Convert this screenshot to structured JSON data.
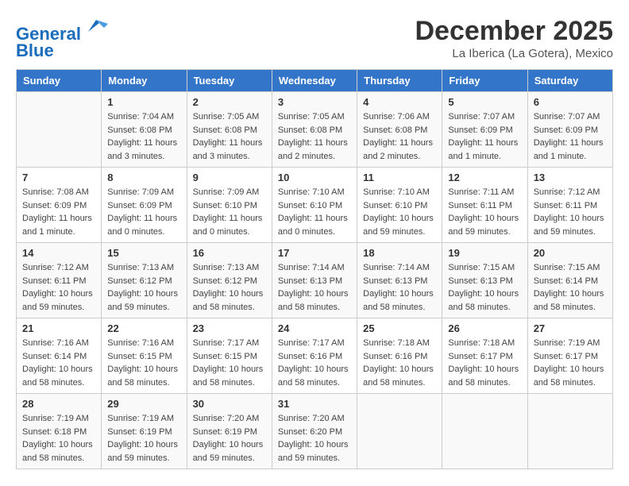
{
  "header": {
    "logo_line1": "General",
    "logo_line2": "Blue",
    "month": "December 2025",
    "location": "La Iberica (La Gotera), Mexico"
  },
  "days_of_week": [
    "Sunday",
    "Monday",
    "Tuesday",
    "Wednesday",
    "Thursday",
    "Friday",
    "Saturday"
  ],
  "weeks": [
    [
      {
        "day": "",
        "info": ""
      },
      {
        "day": "1",
        "info": "Sunrise: 7:04 AM\nSunset: 6:08 PM\nDaylight: 11 hours\nand 3 minutes."
      },
      {
        "day": "2",
        "info": "Sunrise: 7:05 AM\nSunset: 6:08 PM\nDaylight: 11 hours\nand 3 minutes."
      },
      {
        "day": "3",
        "info": "Sunrise: 7:05 AM\nSunset: 6:08 PM\nDaylight: 11 hours\nand 2 minutes."
      },
      {
        "day": "4",
        "info": "Sunrise: 7:06 AM\nSunset: 6:08 PM\nDaylight: 11 hours\nand 2 minutes."
      },
      {
        "day": "5",
        "info": "Sunrise: 7:07 AM\nSunset: 6:09 PM\nDaylight: 11 hours\nand 1 minute."
      },
      {
        "day": "6",
        "info": "Sunrise: 7:07 AM\nSunset: 6:09 PM\nDaylight: 11 hours\nand 1 minute."
      }
    ],
    [
      {
        "day": "7",
        "info": "Sunrise: 7:08 AM\nSunset: 6:09 PM\nDaylight: 11 hours\nand 1 minute."
      },
      {
        "day": "8",
        "info": "Sunrise: 7:09 AM\nSunset: 6:09 PM\nDaylight: 11 hours\nand 0 minutes."
      },
      {
        "day": "9",
        "info": "Sunrise: 7:09 AM\nSunset: 6:10 PM\nDaylight: 11 hours\nand 0 minutes."
      },
      {
        "day": "10",
        "info": "Sunrise: 7:10 AM\nSunset: 6:10 PM\nDaylight: 11 hours\nand 0 minutes."
      },
      {
        "day": "11",
        "info": "Sunrise: 7:10 AM\nSunset: 6:10 PM\nDaylight: 10 hours\nand 59 minutes."
      },
      {
        "day": "12",
        "info": "Sunrise: 7:11 AM\nSunset: 6:11 PM\nDaylight: 10 hours\nand 59 minutes."
      },
      {
        "day": "13",
        "info": "Sunrise: 7:12 AM\nSunset: 6:11 PM\nDaylight: 10 hours\nand 59 minutes."
      }
    ],
    [
      {
        "day": "14",
        "info": "Sunrise: 7:12 AM\nSunset: 6:11 PM\nDaylight: 10 hours\nand 59 minutes."
      },
      {
        "day": "15",
        "info": "Sunrise: 7:13 AM\nSunset: 6:12 PM\nDaylight: 10 hours\nand 59 minutes."
      },
      {
        "day": "16",
        "info": "Sunrise: 7:13 AM\nSunset: 6:12 PM\nDaylight: 10 hours\nand 58 minutes."
      },
      {
        "day": "17",
        "info": "Sunrise: 7:14 AM\nSunset: 6:13 PM\nDaylight: 10 hours\nand 58 minutes."
      },
      {
        "day": "18",
        "info": "Sunrise: 7:14 AM\nSunset: 6:13 PM\nDaylight: 10 hours\nand 58 minutes."
      },
      {
        "day": "19",
        "info": "Sunrise: 7:15 AM\nSunset: 6:13 PM\nDaylight: 10 hours\nand 58 minutes."
      },
      {
        "day": "20",
        "info": "Sunrise: 7:15 AM\nSunset: 6:14 PM\nDaylight: 10 hours\nand 58 minutes."
      }
    ],
    [
      {
        "day": "21",
        "info": "Sunrise: 7:16 AM\nSunset: 6:14 PM\nDaylight: 10 hours\nand 58 minutes."
      },
      {
        "day": "22",
        "info": "Sunrise: 7:16 AM\nSunset: 6:15 PM\nDaylight: 10 hours\nand 58 minutes."
      },
      {
        "day": "23",
        "info": "Sunrise: 7:17 AM\nSunset: 6:15 PM\nDaylight: 10 hours\nand 58 minutes."
      },
      {
        "day": "24",
        "info": "Sunrise: 7:17 AM\nSunset: 6:16 PM\nDaylight: 10 hours\nand 58 minutes."
      },
      {
        "day": "25",
        "info": "Sunrise: 7:18 AM\nSunset: 6:16 PM\nDaylight: 10 hours\nand 58 minutes."
      },
      {
        "day": "26",
        "info": "Sunrise: 7:18 AM\nSunset: 6:17 PM\nDaylight: 10 hours\nand 58 minutes."
      },
      {
        "day": "27",
        "info": "Sunrise: 7:19 AM\nSunset: 6:17 PM\nDaylight: 10 hours\nand 58 minutes."
      }
    ],
    [
      {
        "day": "28",
        "info": "Sunrise: 7:19 AM\nSunset: 6:18 PM\nDaylight: 10 hours\nand 58 minutes."
      },
      {
        "day": "29",
        "info": "Sunrise: 7:19 AM\nSunset: 6:19 PM\nDaylight: 10 hours\nand 59 minutes."
      },
      {
        "day": "30",
        "info": "Sunrise: 7:20 AM\nSunset: 6:19 PM\nDaylight: 10 hours\nand 59 minutes."
      },
      {
        "day": "31",
        "info": "Sunrise: 7:20 AM\nSunset: 6:20 PM\nDaylight: 10 hours\nand 59 minutes."
      },
      {
        "day": "",
        "info": ""
      },
      {
        "day": "",
        "info": ""
      },
      {
        "day": "",
        "info": ""
      }
    ]
  ]
}
